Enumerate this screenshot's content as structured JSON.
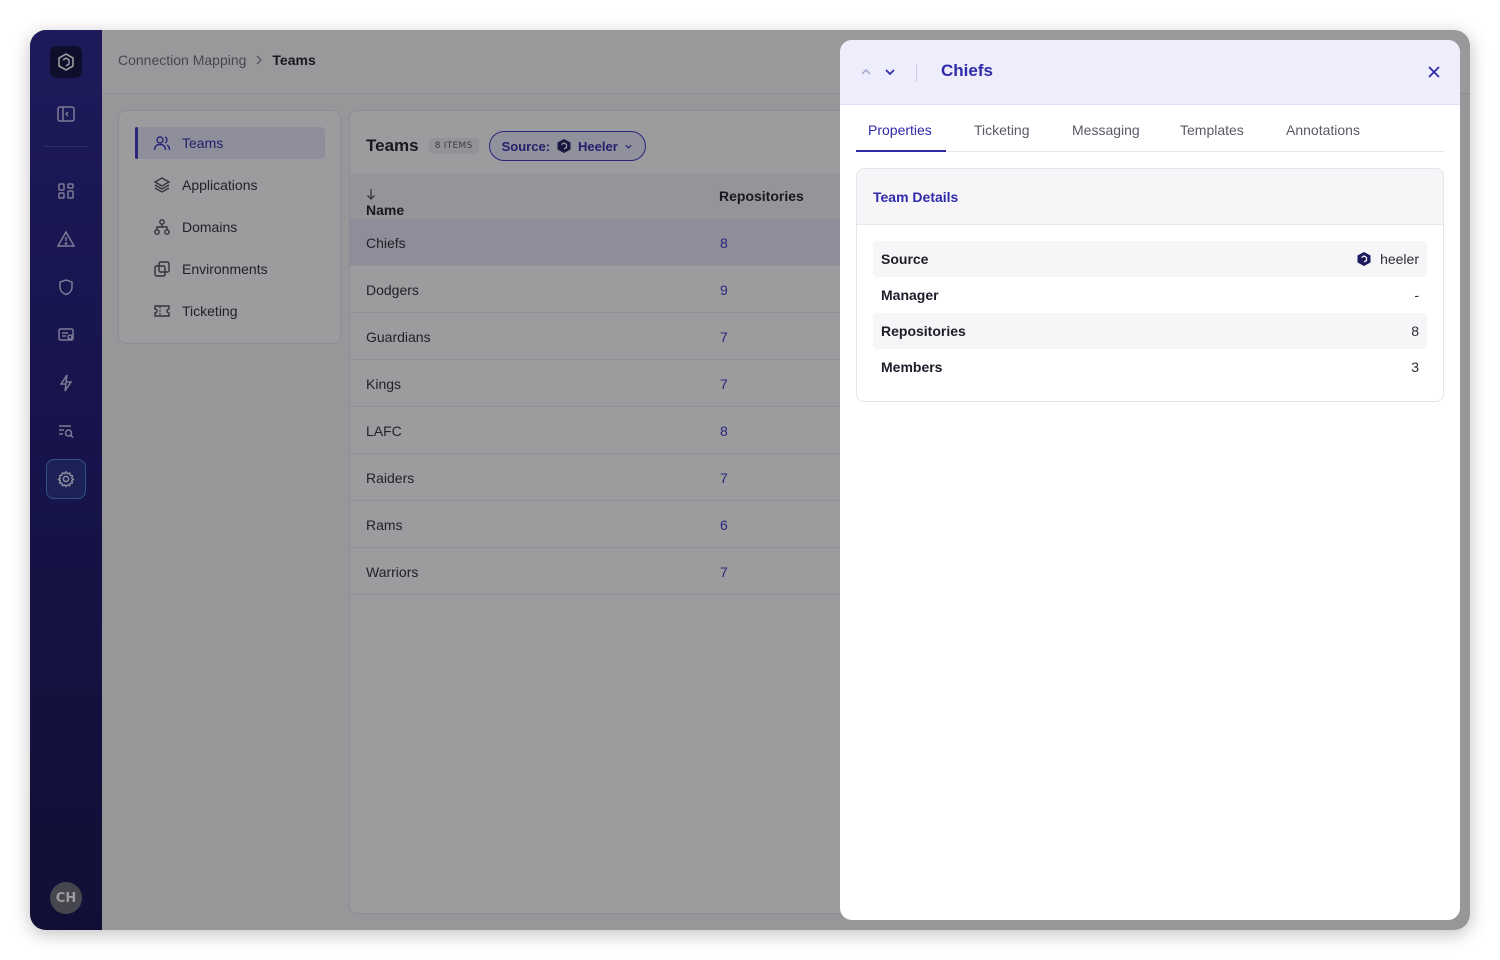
{
  "breadcrumb": {
    "parent": "Connection Mapping",
    "current": "Teams"
  },
  "subnav": {
    "items": [
      {
        "label": "Teams",
        "icon": "users-icon"
      },
      {
        "label": "Applications",
        "icon": "layers-icon"
      },
      {
        "label": "Domains",
        "icon": "hierarchy-icon"
      },
      {
        "label": "Environments",
        "icon": "copy-icon"
      },
      {
        "label": "Ticketing",
        "icon": "ticket-icon"
      }
    ]
  },
  "table": {
    "title": "Teams",
    "count": "8 ITEMS",
    "filter": {
      "label": "Source:",
      "value": "Heeler"
    },
    "columns": {
      "name": "Name",
      "repositories": "Repositories"
    },
    "rows": [
      {
        "name": "Chiefs",
        "repos": "8"
      },
      {
        "name": "Dodgers",
        "repos": "9"
      },
      {
        "name": "Guardians",
        "repos": "7"
      },
      {
        "name": "Kings",
        "repos": "7"
      },
      {
        "name": "LAFC",
        "repos": "8"
      },
      {
        "name": "Raiders",
        "repos": "7"
      },
      {
        "name": "Rams",
        "repos": "6"
      },
      {
        "name": "Warriors",
        "repos": "7"
      }
    ]
  },
  "drawer": {
    "title": "Chiefs",
    "tabs": [
      "Properties",
      "Ticketing",
      "Messaging",
      "Templates",
      "Annotations"
    ],
    "section_title": "Team Details",
    "details": [
      {
        "key": "Source",
        "value": "heeler"
      },
      {
        "key": "Manager",
        "value": "-"
      },
      {
        "key": "Repositories",
        "value": "8"
      },
      {
        "key": "Members",
        "value": "3"
      }
    ]
  },
  "user": {
    "initials": "CH"
  },
  "colors": {
    "accent": "#2f2aa8",
    "rail": "#1a1670",
    "drawer_header": "#eeedfc"
  }
}
